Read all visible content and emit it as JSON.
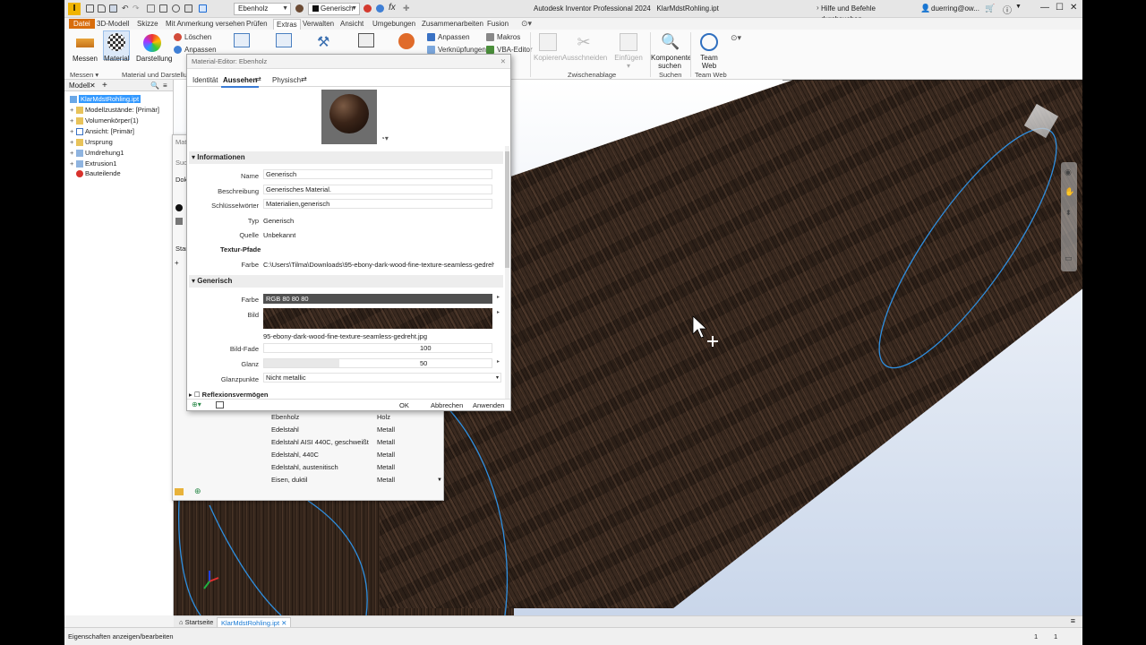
{
  "window": {
    "app_title": "Autodesk Inventor Professional 2024",
    "file_title": "KlarMdstRohling.ipt",
    "help_search": "Hilfe und Befehle durchsuchen...",
    "user": "duerring@ow...",
    "appearance_combo": "Ebenholz",
    "material_combo": "Generisch",
    "fx_label": "fx"
  },
  "menu_tabs": [
    "Datei",
    "3D-Modell",
    "Skizze",
    "Mit Anmerkung versehen",
    "Prüfen",
    "Extras",
    "Verwalten",
    "Ansicht",
    "Umgebungen",
    "Zusammenarbeiten",
    "Fusion"
  ],
  "ribbon": {
    "messen": "Messen",
    "material": "Material",
    "darstellung": "Darstellung",
    "loeschen": "Löschen",
    "anpassen_small": "Anpassen",
    "group_messen": "Messen",
    "group_material": "Material und Darstellung",
    "anpassen": "Anpassen",
    "makros": "Makros",
    "verknuepfungen": "Verknüpfungen",
    "vba_editor": "VBA-Editor",
    "kopieren": "Kopieren",
    "ausschneiden": "Ausschneiden",
    "einfuegen": "Einfügen",
    "group_zwischenablage": "Zwischenablage",
    "komponente_suchen": "Komponente suchen",
    "group_suchen": "Suchen",
    "team_web": "Team Web",
    "group_team_web": "Team Web"
  },
  "browser": {
    "tab": "Modell",
    "items": [
      {
        "label": "KlarMdstRohling.ipt",
        "exp": "",
        "icon": "part"
      },
      {
        "label": "Modellzustände: [Primär]",
        "exp": "+",
        "icon": "folder"
      },
      {
        "label": "Volumenkörper(1)",
        "exp": "+",
        "icon": "folder"
      },
      {
        "label": "Ansicht: [Primär]",
        "exp": "+",
        "icon": "view"
      },
      {
        "label": "Ursprung",
        "exp": "+",
        "icon": "folder"
      },
      {
        "label": "Umdrehung1",
        "exp": "+",
        "icon": "feature"
      },
      {
        "label": "Extrusion1",
        "exp": "+",
        "icon": "feature"
      },
      {
        "label": "Bauteilende",
        "exp": "",
        "icon": "end"
      }
    ]
  },
  "material_browser": {
    "title_stub": "Mat",
    "search_stub": "Suc",
    "doc_stub": "Dok",
    "start_stub": "Star",
    "rows": [
      {
        "name": "Ebenholz",
        "category": "Holz"
      },
      {
        "name": "Edelstahl",
        "category": "Metall"
      },
      {
        "name": "Edelstahl AISI 440C, geschweißt",
        "category": "Metall"
      },
      {
        "name": "Edelstahl, 440C",
        "category": "Metall"
      },
      {
        "name": "Edelstahl, austenitisch",
        "category": "Metall"
      },
      {
        "name": "Eisen, duktil",
        "category": "Metall"
      }
    ]
  },
  "editor": {
    "title": "Material-Editor: Ebenholz",
    "tabs": [
      "Identität",
      "Aussehen",
      "Physisch"
    ],
    "section_info": "Informationen",
    "name_label": "Name",
    "name_value": "Generisch",
    "desc_label": "Beschreibung",
    "desc_value": "Generisches Material.",
    "keywords_label": "Schlüsselwörter",
    "keywords_value": "Materialien,generisch",
    "type_label": "Typ",
    "type_value": "Generisch",
    "source_label": "Quelle",
    "source_value": "Unbekannt",
    "texture_paths": "Textur-Pfade",
    "farbe_label": "Farbe",
    "texture_path_value": "C:\\Users\\Tilma\\Downloads\\95-ebony-dark-wood-fine-texture-seamless-gedreh...",
    "section_generic": "Generisch",
    "color_label": "Farbe",
    "color_value": "RGB 80 80 80",
    "image_label": "Bild",
    "image_file": "95-ebony-dark-wood-fine-texture-seamless-gedreht.jpg",
    "image_fade_label": "Bild-Fade",
    "image_fade_value": "100",
    "gloss_label": "Glanz",
    "gloss_value": "50",
    "highlights_label": "Glanzpunkte",
    "highlights_value": "Nicht metallic",
    "section_reflex": "Reflexionsvermögen",
    "ok": "OK",
    "cancel": "Abbrechen",
    "apply": "Anwenden"
  },
  "doc_tabs": [
    "Startseite",
    "KlarMdstRohling.ipt"
  ],
  "status": {
    "text": "Eigenschaften anzeigen/bearbeiten",
    "count_a": "1",
    "count_b": "1"
  },
  "colors": {
    "accent": "#3a7bd5",
    "file_tab": "#d86d0c",
    "edge": "#2f8fe0",
    "wood": "#3a2a20"
  }
}
